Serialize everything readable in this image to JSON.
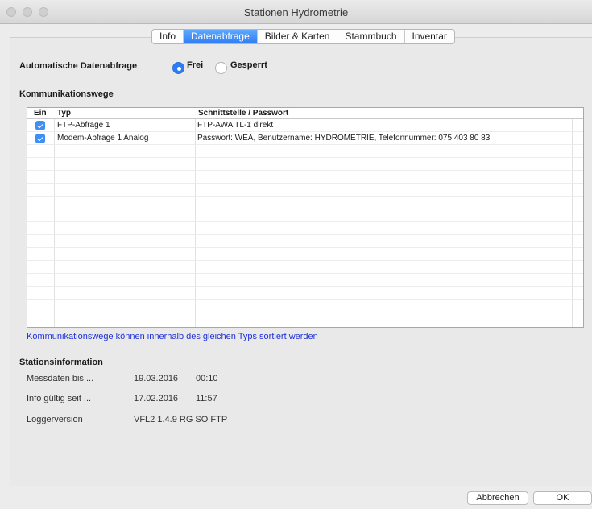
{
  "window": {
    "title": "Stationen Hydrometrie"
  },
  "tabs": [
    {
      "label": "Info",
      "active": false
    },
    {
      "label": "Datenabfrage",
      "active": true
    },
    {
      "label": "Bilder & Karten",
      "active": false
    },
    {
      "label": "Stammbuch",
      "active": false
    },
    {
      "label": "Inventar",
      "active": false
    }
  ],
  "datenabfrage": {
    "label": "Automatische Datenabfrage",
    "options": [
      {
        "label": "Frei",
        "selected": true
      },
      {
        "label": "Gesperrt",
        "selected": false
      }
    ]
  },
  "kommunikationswege": {
    "heading": "Kommunikationswege",
    "columns": [
      "Ein",
      "Typ",
      "Schnittstelle / Passwort"
    ],
    "rows": [
      {
        "enabled": true,
        "typ": "FTP-Abfrage 1",
        "schnittstelle": "FTP-AWA TL-1 direkt"
      },
      {
        "enabled": true,
        "typ": "Modem-Abfrage 1 Analog",
        "schnittstelle": "Passwort: WEA, Benutzername: HYDROMETRIE, Telefonnummer: 075 403 80 83"
      }
    ],
    "hint": "Kommunikationswege können innerhalb des gleichen Typs sortiert werden"
  },
  "stationsinformation": {
    "heading": "Stationsinformation",
    "rows": [
      {
        "label": "Messdaten bis ...",
        "date": "19.03.2016",
        "time": "00:10"
      },
      {
        "label": "Info gültig seit ...",
        "date": "17.02.2016",
        "time": "11:57"
      },
      {
        "label": "Loggerversion",
        "value": "VFL2 1.4.9 RG SO FTP"
      }
    ]
  },
  "buttons": {
    "cancel": "Abbrechen",
    "ok": "OK"
  },
  "colors": {
    "accent": "#2b7cf6",
    "hint_text": "#1f30d8"
  }
}
